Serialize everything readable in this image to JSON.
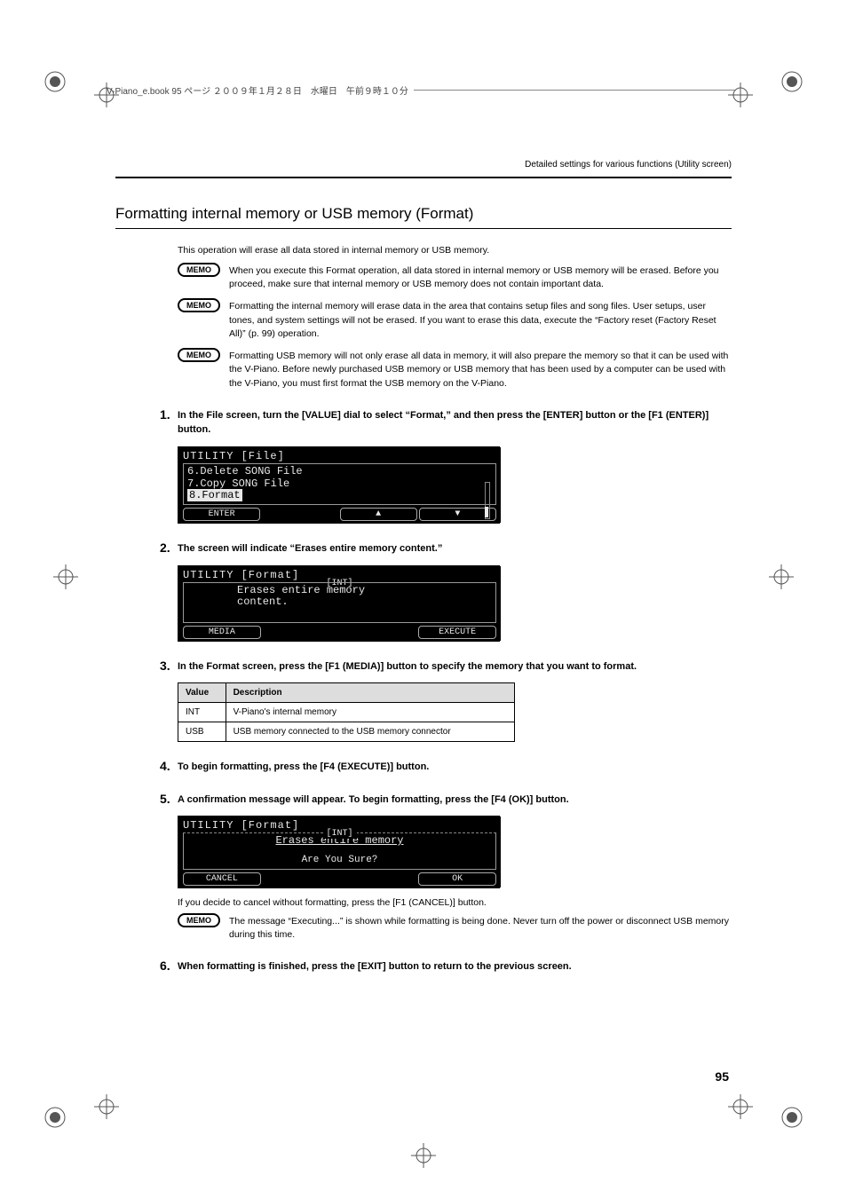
{
  "page_header": {
    "book_line": "V-Piano_e.book  95 ページ  ２００９年１月２８日　水曜日　午前９時１０分"
  },
  "chapter_header": "Detailed settings for various functions (Utility screen)",
  "section_title": "Formatting internal memory or USB memory (Format)",
  "intro": "This operation will erase all data stored in internal memory or USB memory.",
  "memo_label": "MEMO",
  "memos": [
    "When you execute this Format operation, all data stored in internal memory or USB memory will be erased. Before you proceed, make sure that internal memory or USB memory does not contain important data.",
    "Formatting the internal memory will erase data in the area that contains setup files and song files. User setups, user tones, and system settings will not be erased. If you want to erase this data, execute the  “Factory reset (Factory Reset All)” (p. 99) operation.",
    "Formatting USB memory will not only erase all data in memory, it will also prepare the memory so that it can be used with the V-Piano. Before newly purchased USB memory or USB memory that has been used by a computer can be used with the V-Piano, you must first format the USB memory on the V-Piano."
  ],
  "steps": {
    "s1": {
      "num": "1.",
      "main": "In the File screen, turn the [VALUE] dial to select “Format,” and then press the [ENTER] button or the [F1 (ENTER)] button.",
      "lcd": {
        "title": "UTILITY [File]",
        "lines": [
          "6.Delete SONG File",
          "7.Copy SONG File",
          "8.Format"
        ],
        "highlight_index": 2,
        "softkeys": [
          "ENTER",
          "",
          "▲",
          "▼"
        ]
      }
    },
    "s2": {
      "num": "2.",
      "main": "The screen will indicate “Erases entire memory content.”",
      "lcd": {
        "title": "UTILITY [Format]",
        "subtitle": "[INT]",
        "body_line1": "Erases entire memory",
        "body_line2": "content.",
        "softkeys": [
          "MEDIA",
          "",
          "",
          "EXECUTE"
        ]
      }
    },
    "s3": {
      "num": "3.",
      "main": "In the Format screen, press the [F1 (MEDIA)] button to specify the memory that you want to format.",
      "table": {
        "headers": [
          "Value",
          "Description"
        ],
        "rows": [
          [
            "INT",
            "V-Piano's internal memory"
          ],
          [
            "USB",
            "USB memory connected to the USB memory connector"
          ]
        ]
      }
    },
    "s4": {
      "num": "4.",
      "main": "To begin formatting, press the [F4 (EXECUTE)] button."
    },
    "s5": {
      "num": "5.",
      "main": "A confirmation message will appear. To begin formatting, press the [F4 (OK)] button.",
      "lcd": {
        "title": "UTILITY [Format]",
        "subtitle": "[INT]",
        "body_line1": "Erases entire memory",
        "confirm": "Are You Sure?",
        "softkeys": [
          "CANCEL",
          "",
          "",
          "OK"
        ]
      },
      "after": "If you decide to cancel without formatting, press the [F1 (CANCEL)] button.",
      "memo": "The message “Executing...” is shown while formatting is being done. Never turn off the power or disconnect USB memory during this time."
    },
    "s6": {
      "num": "6.",
      "main": "When formatting is finished, press the [EXIT] button to return to the previous screen."
    }
  },
  "page_number": "95"
}
